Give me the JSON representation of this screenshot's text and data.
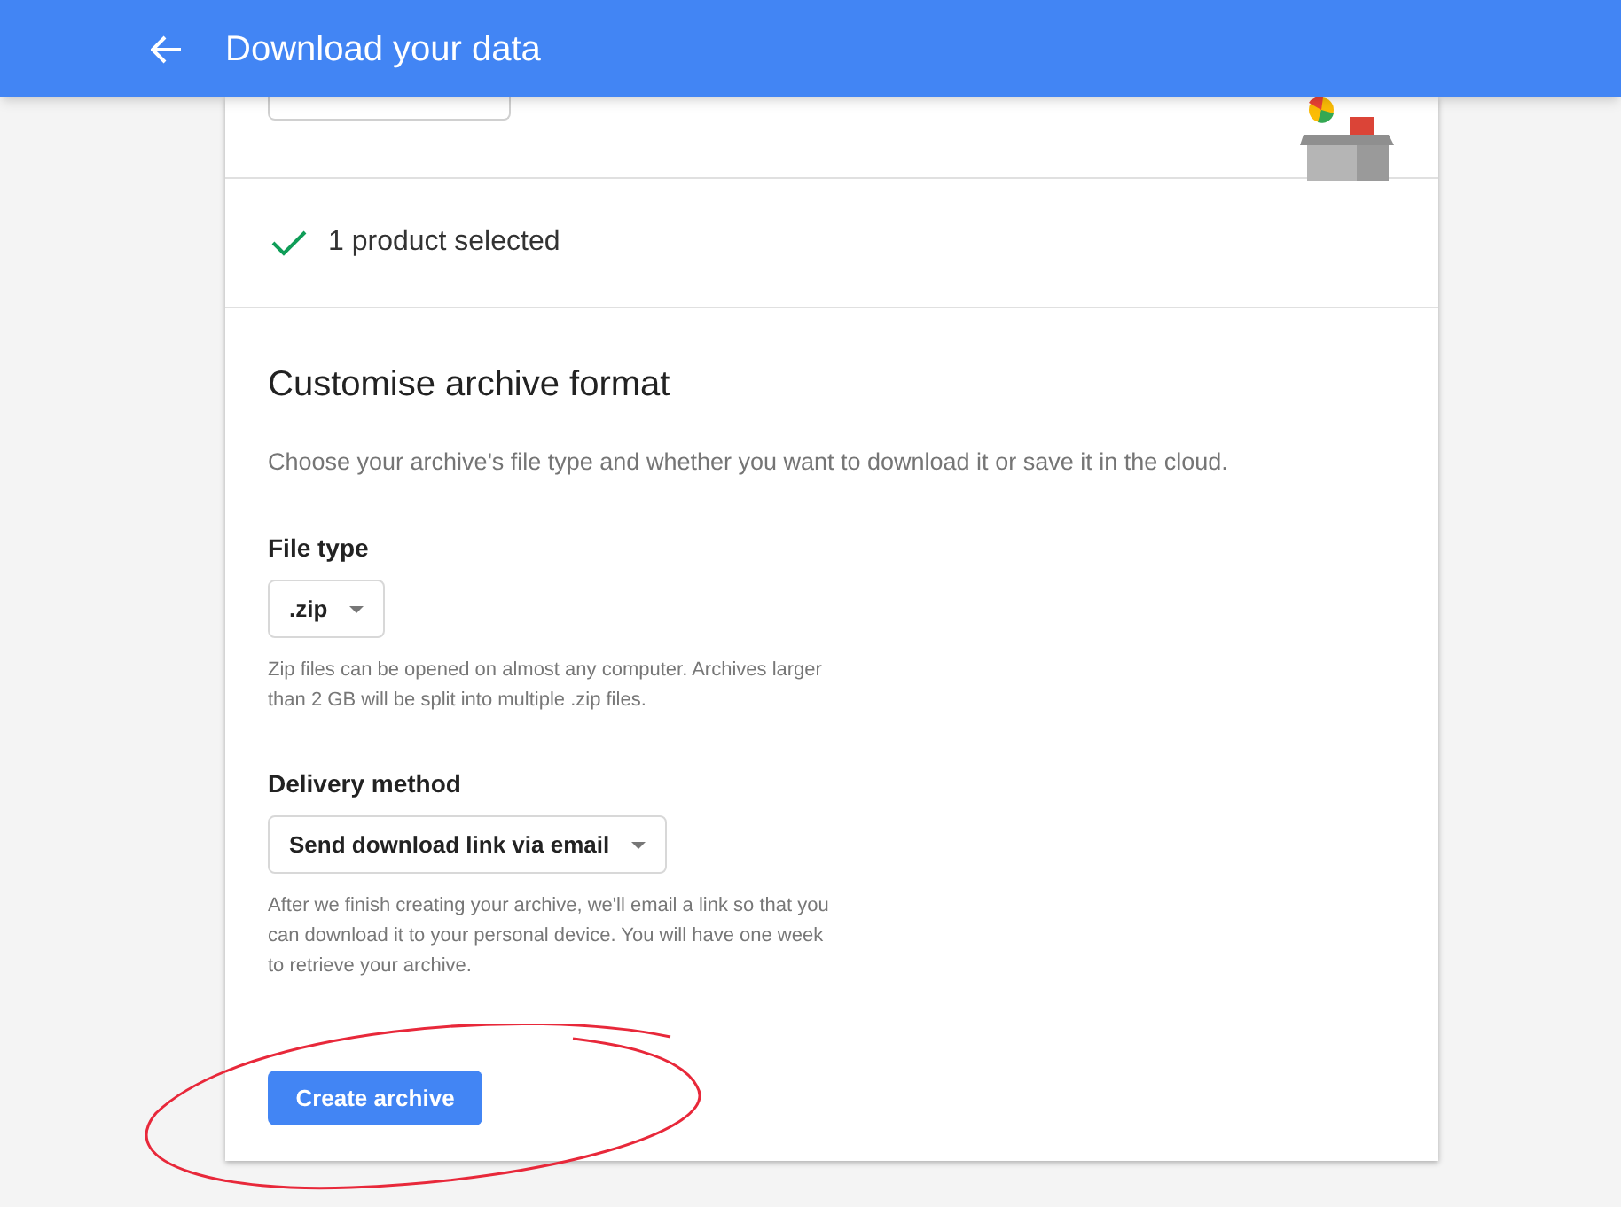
{
  "header": {
    "title": "Download your data"
  },
  "selection": {
    "text": "1 product selected"
  },
  "format": {
    "title": "Customise archive format",
    "description": "Choose your archive's file type and whether you want to download it or save it in the cloud.",
    "fields": [
      {
        "label": "File type",
        "value": ".zip",
        "help": "Zip files can be opened on almost any computer. Archives larger than 2 GB will be split into multiple .zip files."
      },
      {
        "label": "Delivery method",
        "value": "Send download link via email",
        "help": "After we finish creating your archive, we'll email a link so that you can download it to your personal device. You will have one week to retrieve your archive."
      }
    ]
  },
  "create_button": {
    "label": "Create archive"
  }
}
